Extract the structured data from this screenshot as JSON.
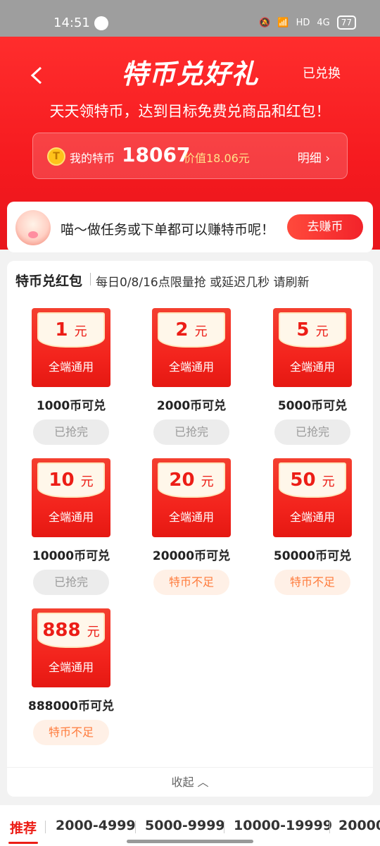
{
  "status_bar": {
    "time": "14:51",
    "network": "4G",
    "hd": "HD",
    "battery": "77"
  },
  "header": {
    "title": "特币兑好礼",
    "redeemed_link": "已兑换",
    "subtitle": "天天领特币，达到目标免费兑商品和红包！",
    "coin_label": "我的特币",
    "coin_value": "18067",
    "coin_worth": "价值18.06元",
    "detail_link": "明细",
    "coin_symbol": "T"
  },
  "earn_banner": {
    "text": "喵～做任务或下单都可以赚特币呢！",
    "button": "去赚币"
  },
  "redpacket_section": {
    "title": "特币兑红包",
    "subtitle": "每日0/8/16点限量抢 或延迟几秒 请刷新",
    "items": [
      {
        "amount": "1",
        "unit": "元",
        "label": "全端通用",
        "price": "1000币可兑",
        "status": "已抢完",
        "status_type": "done"
      },
      {
        "amount": "2",
        "unit": "元",
        "label": "全端通用",
        "price": "2000币可兑",
        "status": "已抢完",
        "status_type": "done"
      },
      {
        "amount": "5",
        "unit": "元",
        "label": "全端通用",
        "price": "5000币可兑",
        "status": "已抢完",
        "status_type": "done"
      },
      {
        "amount": "10",
        "unit": "元",
        "label": "全端通用",
        "price": "10000币可兑",
        "status": "已抢完",
        "status_type": "done"
      },
      {
        "amount": "20",
        "unit": "元",
        "label": "全端通用",
        "price": "20000币可兑",
        "status": "特币不足",
        "status_type": "short"
      },
      {
        "amount": "50",
        "unit": "元",
        "label": "全端通用",
        "price": "50000币可兑",
        "status": "特币不足",
        "status_type": "short"
      },
      {
        "amount": "888",
        "unit": "元",
        "label": "全端通用",
        "price": "888000币可兑",
        "status": "特币不足",
        "status_type": "short"
      }
    ],
    "collapse_label": "收起"
  },
  "bottom_tabs": [
    "推荐",
    "2000-4999",
    "5000-9999",
    "10000-19999",
    "20000"
  ],
  "colors": {
    "brand_red": "#ec1d16",
    "header_red": "#f51a1f",
    "short_orange": "#ff7a3a"
  }
}
